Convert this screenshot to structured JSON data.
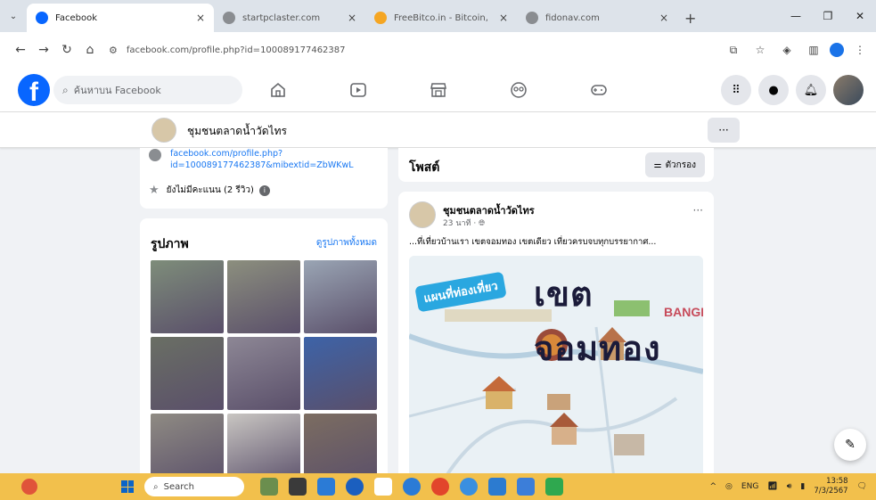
{
  "browser": {
    "tabs": [
      {
        "title": "Facebook",
        "active": true,
        "favicon_color": "#0866ff"
      },
      {
        "title": "startpclaster.com",
        "active": false,
        "favicon_color": "#8a8d91"
      },
      {
        "title": "FreeBitco.in - Bitcoin, Bitcoin F",
        "active": false,
        "favicon_color": "#f5a623"
      },
      {
        "title": "fidonav.com",
        "active": false,
        "favicon_color": "#8a8d91"
      }
    ],
    "url": "facebook.com/profile.php?id=100089177462387"
  },
  "fb_header": {
    "search_placeholder": "ค้นหาบน Facebook"
  },
  "profile": {
    "name": "ชุมชนตลาดน้ำวัดไทร",
    "link_text": "facebook.com/profile.php?id=100089177462387&mibextid=ZbWKwL",
    "rating_text": "ยังไม่มีคะแนน (2 รีวิว)",
    "photos_title": "รูปภาพ",
    "photos_see_all": "ดูรูปภาพทั้งหมด",
    "photos": [
      "#7e8d7a",
      "#8c8f7e",
      "#9aa5b4",
      "#6a6f64",
      "#8d8795",
      "#3d63a8",
      "#8f8b83",
      "#c9c6c2",
      "#7c6d61"
    ]
  },
  "posts": {
    "title": "โพสต์",
    "filter_label": "ตัวกรอง",
    "post": {
      "author": "ชุมชนตลาดน้ำวัดไทร",
      "time": "23 นาที · ",
      "text": "...ที่เที่ยวบ้านเรา เขตจอมทอง เขตเดียว เที่ยวครบจบทุกบรรยากาศ...",
      "image_title": "เขตจอมทอง",
      "image_subtitle": "แผนที่ท่องเที่ยว",
      "image_city": "BANGKOK"
    }
  },
  "taskbar": {
    "search_label": "Search",
    "lang": "ENG",
    "time": "13:58",
    "date": "7/3/2567"
  },
  "colors": {
    "fb_blue": "#0866ff",
    "taskbar": "#f2c04c",
    "link_blue": "#1877f2"
  }
}
